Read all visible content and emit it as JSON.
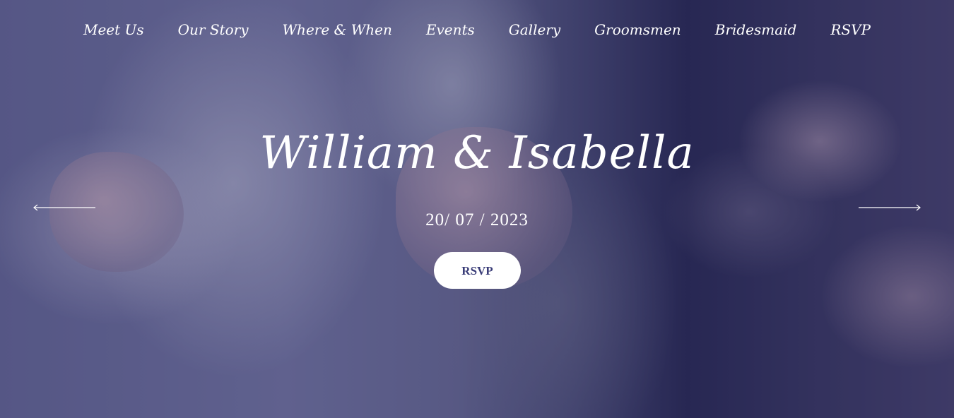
{
  "nav": {
    "items": [
      {
        "label": "Meet Us"
      },
      {
        "label": "Our Story"
      },
      {
        "label": "Where & When"
      },
      {
        "label": "Events"
      },
      {
        "label": "Gallery"
      },
      {
        "label": "Groomsmen"
      },
      {
        "label": "Bridesmaid"
      },
      {
        "label": "RSVP"
      }
    ]
  },
  "hero": {
    "title": "William & Isabella",
    "date": "20/ 07 / 2023",
    "rsvp_label": "RSVP",
    "prev_icon": "arrow-left-icon",
    "next_icon": "arrow-right-icon"
  },
  "colors": {
    "overlay": "#1c1c50",
    "button_text": "#3a3d78",
    "text": "#ffffff"
  }
}
